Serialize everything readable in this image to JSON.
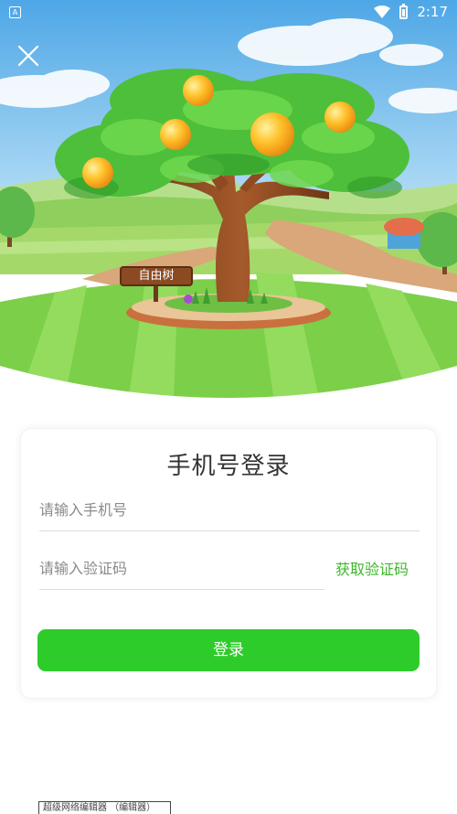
{
  "status_bar": {
    "notification_badge": "A",
    "time": "2:17",
    "icons": [
      "wifi-icon",
      "battery-icon"
    ]
  },
  "hero": {
    "sign_text": "自由树"
  },
  "login": {
    "title": "手机号登录",
    "phone_placeholder": "请输入手机号",
    "code_placeholder": "请输入验证码",
    "get_code_label": "获取验证码",
    "submit_label": "登录"
  },
  "watermark": {
    "text": "超级网络编辑器 （编辑器）"
  },
  "colors": {
    "accent": "#2ecc2a",
    "link": "#3cb72a",
    "sky": "#6fb8ea",
    "grass": "#9fdc5c"
  }
}
